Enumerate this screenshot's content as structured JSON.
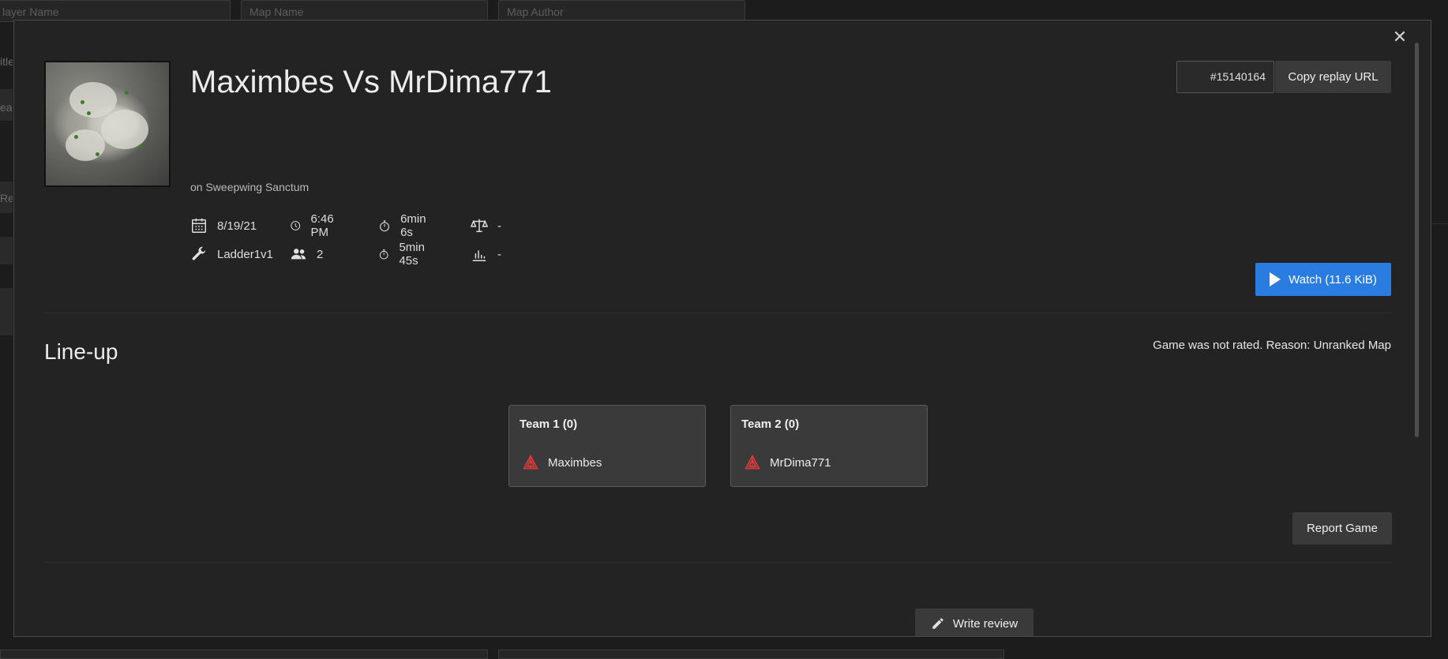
{
  "background": {
    "filters": [
      {
        "placeholder": "Player Name",
        "visible": "layer Name"
      },
      {
        "placeholder": "Map Name",
        "visible": "Map Name"
      },
      {
        "placeholder": "Map Author",
        "visible": "Map Author"
      }
    ],
    "left_fragments": [
      "itle",
      "ead",
      "Re"
    ]
  },
  "replay": {
    "title": "Maximbes Vs MrDima771",
    "map_line": "on Sweepwing Sanctum",
    "id": "#15140164",
    "copy_label": "Copy replay URL",
    "watch_label": "Watch (11.6 KiB)",
    "info": {
      "date": "8/19/21",
      "time": "6:46 PM",
      "duration": "6min 6s",
      "rating": "-",
      "mod": "Ladder1v1",
      "players": "2",
      "real_duration": "5min 45s",
      "quality": "-"
    }
  },
  "lineup": {
    "title": "Line-up",
    "rating_note": "Game was not rated. Reason: Unranked Map",
    "teams": [
      {
        "name": "Team 1 (0)",
        "player": "Maximbes",
        "faction": "cybran-icon"
      },
      {
        "name": "Team 2 (0)",
        "player": "MrDima771",
        "faction": "cybran-icon"
      }
    ]
  },
  "actions": {
    "report_label": "Report Game",
    "review_label": "Write review"
  },
  "colors": {
    "accent": "#2a7ce0",
    "faction": "#e03a3a"
  }
}
